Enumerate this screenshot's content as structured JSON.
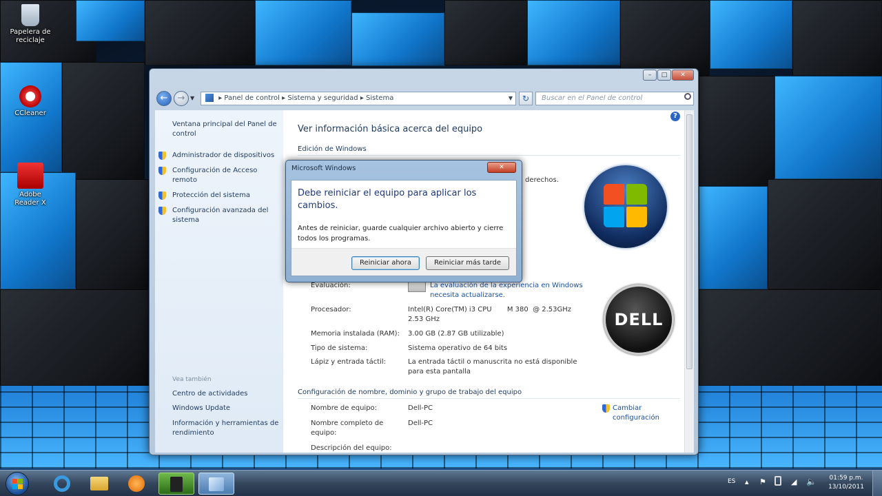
{
  "desktop": {
    "icons": [
      {
        "label": "Papelera de reciclaje"
      },
      {
        "label": "CCleaner"
      },
      {
        "label": "Adobe Reader X"
      }
    ]
  },
  "window": {
    "controls": {
      "minimize": "–",
      "maximize": "□",
      "close": "✕"
    },
    "nav": {
      "back": "←",
      "forward": "→",
      "breadcrumb": [
        "Panel de control",
        "Sistema y seguridad",
        "Sistema"
      ],
      "separator": "▸",
      "refresh": "↻",
      "search_placeholder": "Buscar en el Panel de control"
    },
    "help": "?",
    "sidebar": {
      "home": "Ventana principal del Panel de control",
      "tasks": [
        "Administrador de dispositivos",
        "Configuración de Acceso remoto",
        "Protección del sistema",
        "Configuración avanzada del sistema"
      ],
      "see_also_title": "Vea también",
      "see_also": [
        "Centro de actividades",
        "Windows Update",
        "Información y herramientas de rendimiento"
      ]
    },
    "main": {
      "title": "Ver información básica acerca del equipo",
      "edition_heading": "Edición de Windows",
      "rights_fragment": "derechos.",
      "system": {
        "rating_label": "Evaluación:",
        "rating_value": "La evaluación de la experiencia en Windows necesita actualizarse.",
        "processor_label": "Procesador:",
        "processor_value": "Intel(R) Core(TM) i3 CPU       M 380  @ 2.53GHz   2.53 GHz",
        "memory_label": "Memoria instalada (RAM):",
        "memory_value": "3.00 GB (2.87 GB utilizable)",
        "type_label": "Tipo de sistema:",
        "type_value": "Sistema operativo de 64 bits",
        "pen_label": "Lápiz y entrada táctil:",
        "pen_value": "La entrada táctil o manuscrita no está disponible para esta pantalla"
      },
      "computer": {
        "heading": "Configuración de nombre, dominio y grupo de trabajo del equipo",
        "name_label": "Nombre de equipo:",
        "name_value": "Dell-PC",
        "fullname_label": "Nombre completo de equipo:",
        "fullname_value": "Dell-PC",
        "desc_label": "Descripción del equipo:",
        "change_link": "Cambiar configuración"
      },
      "oem_logo": "DELL"
    }
  },
  "dialog": {
    "title": "Microsoft Windows",
    "close": "✕",
    "heading": "Debe reiniciar el equipo para aplicar los cambios.",
    "message": "Antes de reiniciar, guarde cualquier archivo abierto y cierre todos los programas.",
    "restart_now": "Reiniciar ahora",
    "restart_later": "Reiniciar más tarde"
  },
  "taskbar": {
    "language": "ES",
    "time": "01:59 p.m.",
    "date": "13/10/2011"
  }
}
